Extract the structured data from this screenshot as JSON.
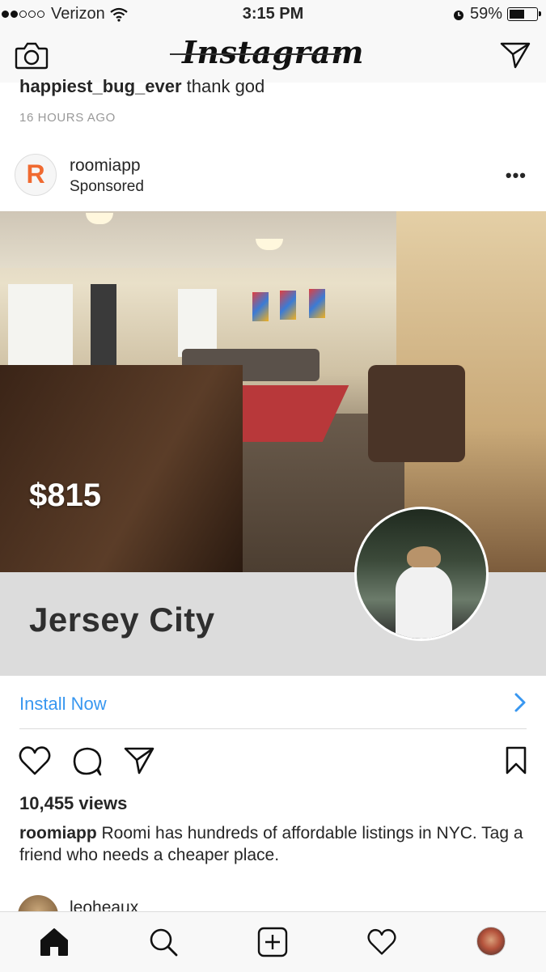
{
  "status_bar": {
    "carrier": "Verizon",
    "time": "3:15 PM",
    "battery": "59%",
    "battery_level": 0.59
  },
  "nav": {
    "title": "Instagram"
  },
  "previous_post": {
    "comment_user": "happiest_bug_ever",
    "comment_text": "thank god",
    "timestamp": "16 HOURS AGO"
  },
  "post": {
    "username": "roomiapp",
    "subtitle": "Sponsored",
    "avatar_letter": "R",
    "price_overlay": "$815",
    "city": "Jersey City",
    "cta": "Install Now",
    "views": "10,455 views",
    "caption_user": "roomiapp",
    "caption_text": "Roomi has hundreds of affordable listings in NYC. Tag a friend who needs a cheaper place."
  },
  "next_post": {
    "username": "leoheaux"
  },
  "colors": {
    "link_blue": "#3897f0",
    "brand_orange": "#f06a30"
  },
  "icons": [
    "camera-icon",
    "direct-message-icon",
    "more-options-icon",
    "chevron-right-icon",
    "heart-icon",
    "comment-icon",
    "share-icon",
    "bookmark-icon",
    "home-icon",
    "search-icon",
    "add-post-icon",
    "activity-heart-icon",
    "profile-avatar"
  ]
}
